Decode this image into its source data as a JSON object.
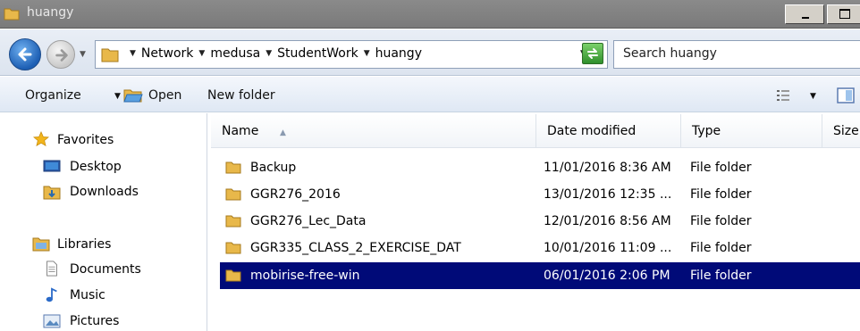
{
  "window": {
    "title": "huangy"
  },
  "address": {
    "crumbs": [
      "Network",
      "medusa",
      "StudentWork",
      "huangy"
    ]
  },
  "search": {
    "placeholder": "Search huangy"
  },
  "toolbar": {
    "organize_label": "Organize",
    "open_label": "Open",
    "new_folder_label": "New folder"
  },
  "nav": {
    "favorites_label": "Favorites",
    "desktop_label": "Desktop",
    "downloads_label": "Downloads",
    "libraries_label": "Libraries",
    "documents_label": "Documents",
    "music_label": "Music",
    "pictures_label": "Pictures"
  },
  "columns": {
    "name": "Name",
    "date": "Date modified",
    "type": "Type",
    "size": "Size"
  },
  "files": [
    {
      "name": "Backup",
      "date": "11/01/2016 8:36 AM",
      "type": "File folder"
    },
    {
      "name": "GGR276_2016",
      "date": "13/01/2016 12:35 ...",
      "type": "File folder"
    },
    {
      "name": "GGR276_Lec_Data",
      "date": "12/01/2016 8:56 AM",
      "type": "File folder"
    },
    {
      "name": "GGR335_CLASS_2_EXERCISE_DAT",
      "date": "10/01/2016 11:09 ...",
      "type": "File folder"
    },
    {
      "name": "mobirise-free-win",
      "date": "06/01/2016 2:06 PM",
      "type": "File folder"
    }
  ],
  "colors": {
    "selection": "#000a78",
    "folder": "#e8b84a"
  }
}
